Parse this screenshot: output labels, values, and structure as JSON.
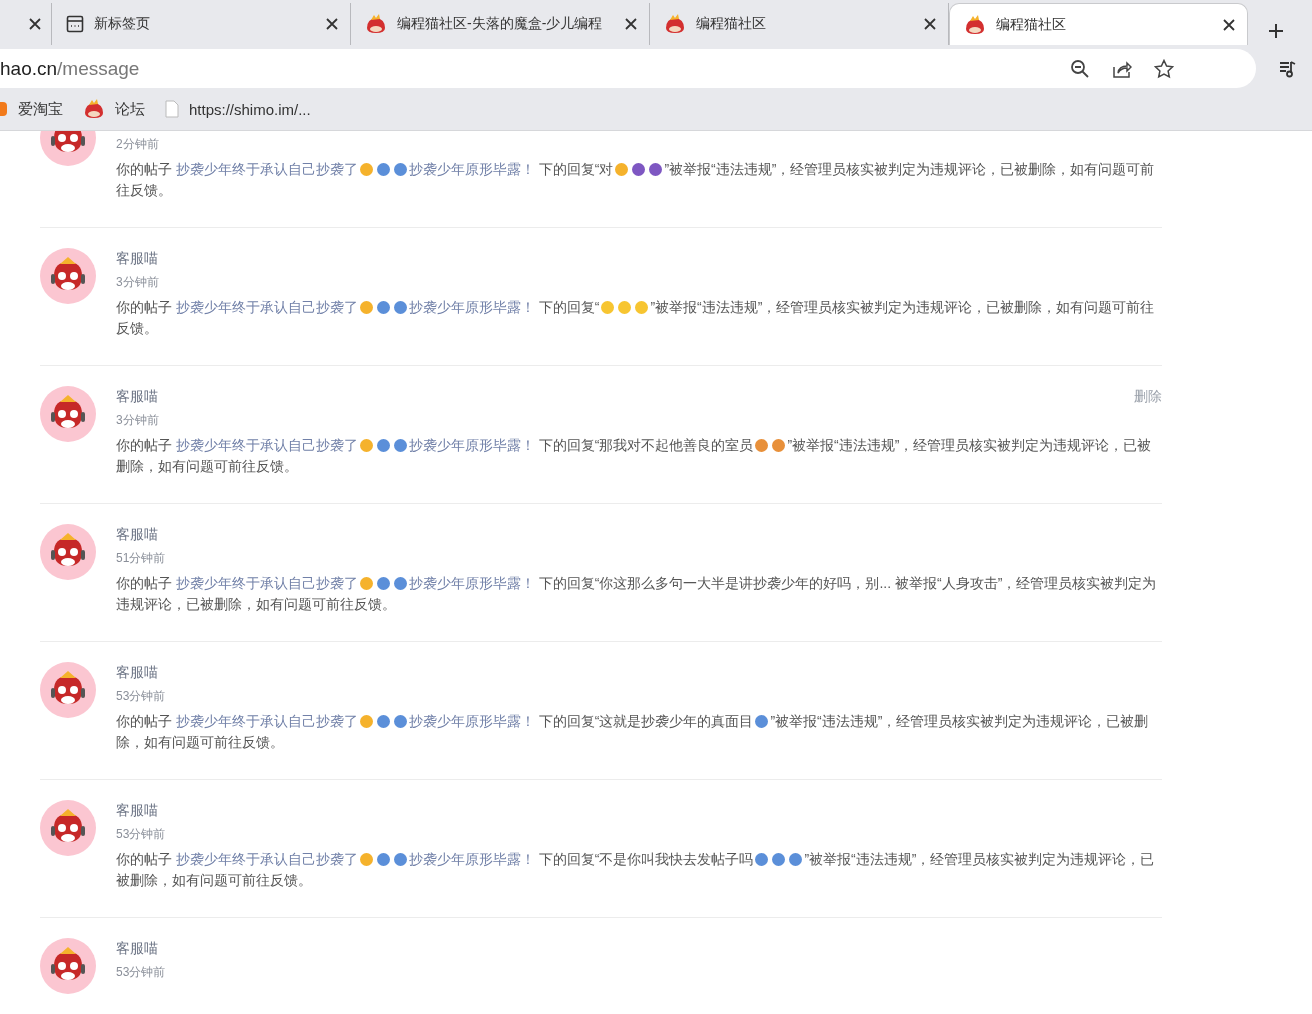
{
  "tabs": [
    {
      "selected": false
    },
    {
      "title": "新标签页",
      "selected": false
    },
    {
      "title": "编程猫社区-失落的魔盒-少儿编程",
      "selected": false
    },
    {
      "title": "编程猫社区",
      "selected": false
    },
    {
      "title": "编程猫社区",
      "selected": true
    }
  ],
  "address": {
    "host": "hao.cn",
    "path": "/message"
  },
  "bookmarks": [
    {
      "label": "爱淘宝"
    },
    {
      "label": "论坛"
    },
    {
      "label": "https://shimo.im/..."
    }
  ],
  "messages": [
    {
      "time": "2分钟前",
      "body": [
        {
          "kind": "text",
          "text": "你的帖子 "
        },
        {
          "kind": "link",
          "parts": [
            {
              "kind": "text",
              "text": "抄袭少年终于承认自己抄袭了"
            },
            {
              "kind": "emoji",
              "color": "#f5b22c"
            },
            {
              "kind": "emoji",
              "color": "#5b8fd9"
            },
            {
              "kind": "emoji",
              "color": "#5b8fd9"
            },
            {
              "kind": "text",
              "text": "抄袭少年原形毕露！"
            }
          ]
        },
        {
          "kind": "text",
          "text": " 下的回复“对"
        },
        {
          "kind": "emoji",
          "color": "#f5b22c"
        },
        {
          "kind": "emoji",
          "color": "#7e57c2"
        },
        {
          "kind": "emoji",
          "color": "#7e57c2"
        },
        {
          "kind": "text",
          "text": "”被举报“违法违规”，经管理员核实被判定为违规评论，已被删除，如有问题可前往反馈。"
        }
      ]
    },
    {
      "name": "客服喵",
      "time": "3分钟前",
      "body": [
        {
          "kind": "text",
          "text": "你的帖子 "
        },
        {
          "kind": "link",
          "parts": [
            {
              "kind": "text",
              "text": "抄袭少年终于承认自己抄袭了"
            },
            {
              "kind": "emoji",
              "color": "#f5b22c"
            },
            {
              "kind": "emoji",
              "color": "#5b8fd9"
            },
            {
              "kind": "emoji",
              "color": "#5b8fd9"
            },
            {
              "kind": "text",
              "text": "抄袭少年原形毕露！"
            }
          ]
        },
        {
          "kind": "text",
          "text": " 下的回复“"
        },
        {
          "kind": "emoji",
          "color": "#f7c531"
        },
        {
          "kind": "emoji",
          "color": "#f7c531"
        },
        {
          "kind": "emoji",
          "color": "#f7c531"
        },
        {
          "kind": "text",
          "text": "”被举报“违法违规”，经管理员核实被判定为违规评论，已被删除，如有问题可前往反馈。"
        }
      ]
    },
    {
      "name": "客服喵",
      "time": "3分钟前",
      "action": "删除",
      "body": [
        {
          "kind": "text",
          "text": "你的帖子 "
        },
        {
          "kind": "link",
          "parts": [
            {
              "kind": "text",
              "text": "抄袭少年终于承认自己抄袭了"
            },
            {
              "kind": "emoji",
              "color": "#f5b22c"
            },
            {
              "kind": "emoji",
              "color": "#5b8fd9"
            },
            {
              "kind": "emoji",
              "color": "#5b8fd9"
            },
            {
              "kind": "text",
              "text": "抄袭少年原形毕露！"
            }
          ]
        },
        {
          "kind": "text",
          "text": " 下的回复“那我对不起他善良的室员"
        },
        {
          "kind": "emoji",
          "color": "#e8903a"
        },
        {
          "kind": "emoji",
          "color": "#e8903a"
        },
        {
          "kind": "text",
          "text": "”被举报“违法违规”，经管理员核实被判定为违规评论，已被删除，如有问题可前往反馈。"
        }
      ]
    },
    {
      "name": "客服喵",
      "time": "51分钟前",
      "body": [
        {
          "kind": "text",
          "text": "你的帖子 "
        },
        {
          "kind": "link",
          "parts": [
            {
              "kind": "text",
              "text": "抄袭少年终于承认自己抄袭了"
            },
            {
              "kind": "emoji",
              "color": "#f5b22c"
            },
            {
              "kind": "emoji",
              "color": "#5b8fd9"
            },
            {
              "kind": "emoji",
              "color": "#5b8fd9"
            },
            {
              "kind": "text",
              "text": "抄袭少年原形毕露！"
            }
          ]
        },
        {
          "kind": "text",
          "text": " 下的回复“你这那么多句一大半是讲抄袭少年的好吗，别... 被举报“人身攻击”，经管理员核实被判定为违规评论，已被删除，如有问题可前往反馈。"
        }
      ]
    },
    {
      "name": "客服喵",
      "time": "53分钟前",
      "body": [
        {
          "kind": "text",
          "text": "你的帖子 "
        },
        {
          "kind": "link",
          "parts": [
            {
              "kind": "text",
              "text": "抄袭少年终于承认自己抄袭了"
            },
            {
              "kind": "emoji",
              "color": "#f5b22c"
            },
            {
              "kind": "emoji",
              "color": "#5b8fd9"
            },
            {
              "kind": "emoji",
              "color": "#5b8fd9"
            },
            {
              "kind": "text",
              "text": "抄袭少年原形毕露！"
            }
          ]
        },
        {
          "kind": "text",
          "text": " 下的回复“这就是抄袭少年的真面目"
        },
        {
          "kind": "emoji",
          "color": "#5b8fd9"
        },
        {
          "kind": "text",
          "text": "”被举报“违法违规”，经管理员核实被判定为违规评论，已被删除，如有问题可前往反馈。"
        }
      ]
    },
    {
      "name": "客服喵",
      "time": "53分钟前",
      "body": [
        {
          "kind": "text",
          "text": "你的帖子 "
        },
        {
          "kind": "link",
          "parts": [
            {
              "kind": "text",
              "text": "抄袭少年终于承认自己抄袭了"
            },
            {
              "kind": "emoji",
              "color": "#f5b22c"
            },
            {
              "kind": "emoji",
              "color": "#5b8fd9"
            },
            {
              "kind": "emoji",
              "color": "#5b8fd9"
            },
            {
              "kind": "text",
              "text": "抄袭少年原形毕露！"
            }
          ]
        },
        {
          "kind": "text",
          "text": " 下的回复“不是你叫我快去发帖子吗"
        },
        {
          "kind": "emoji",
          "color": "#5b8fd9"
        },
        {
          "kind": "emoji",
          "color": "#5b8fd9"
        },
        {
          "kind": "emoji",
          "color": "#5b8fd9"
        },
        {
          "kind": "text",
          "text": "”被举报“违法违规”，经管理员核实被判定为违规评论，已被删除，如有问题可前往反馈。"
        }
      ]
    },
    {
      "name": "客服喵",
      "time": "53分钟前"
    }
  ]
}
